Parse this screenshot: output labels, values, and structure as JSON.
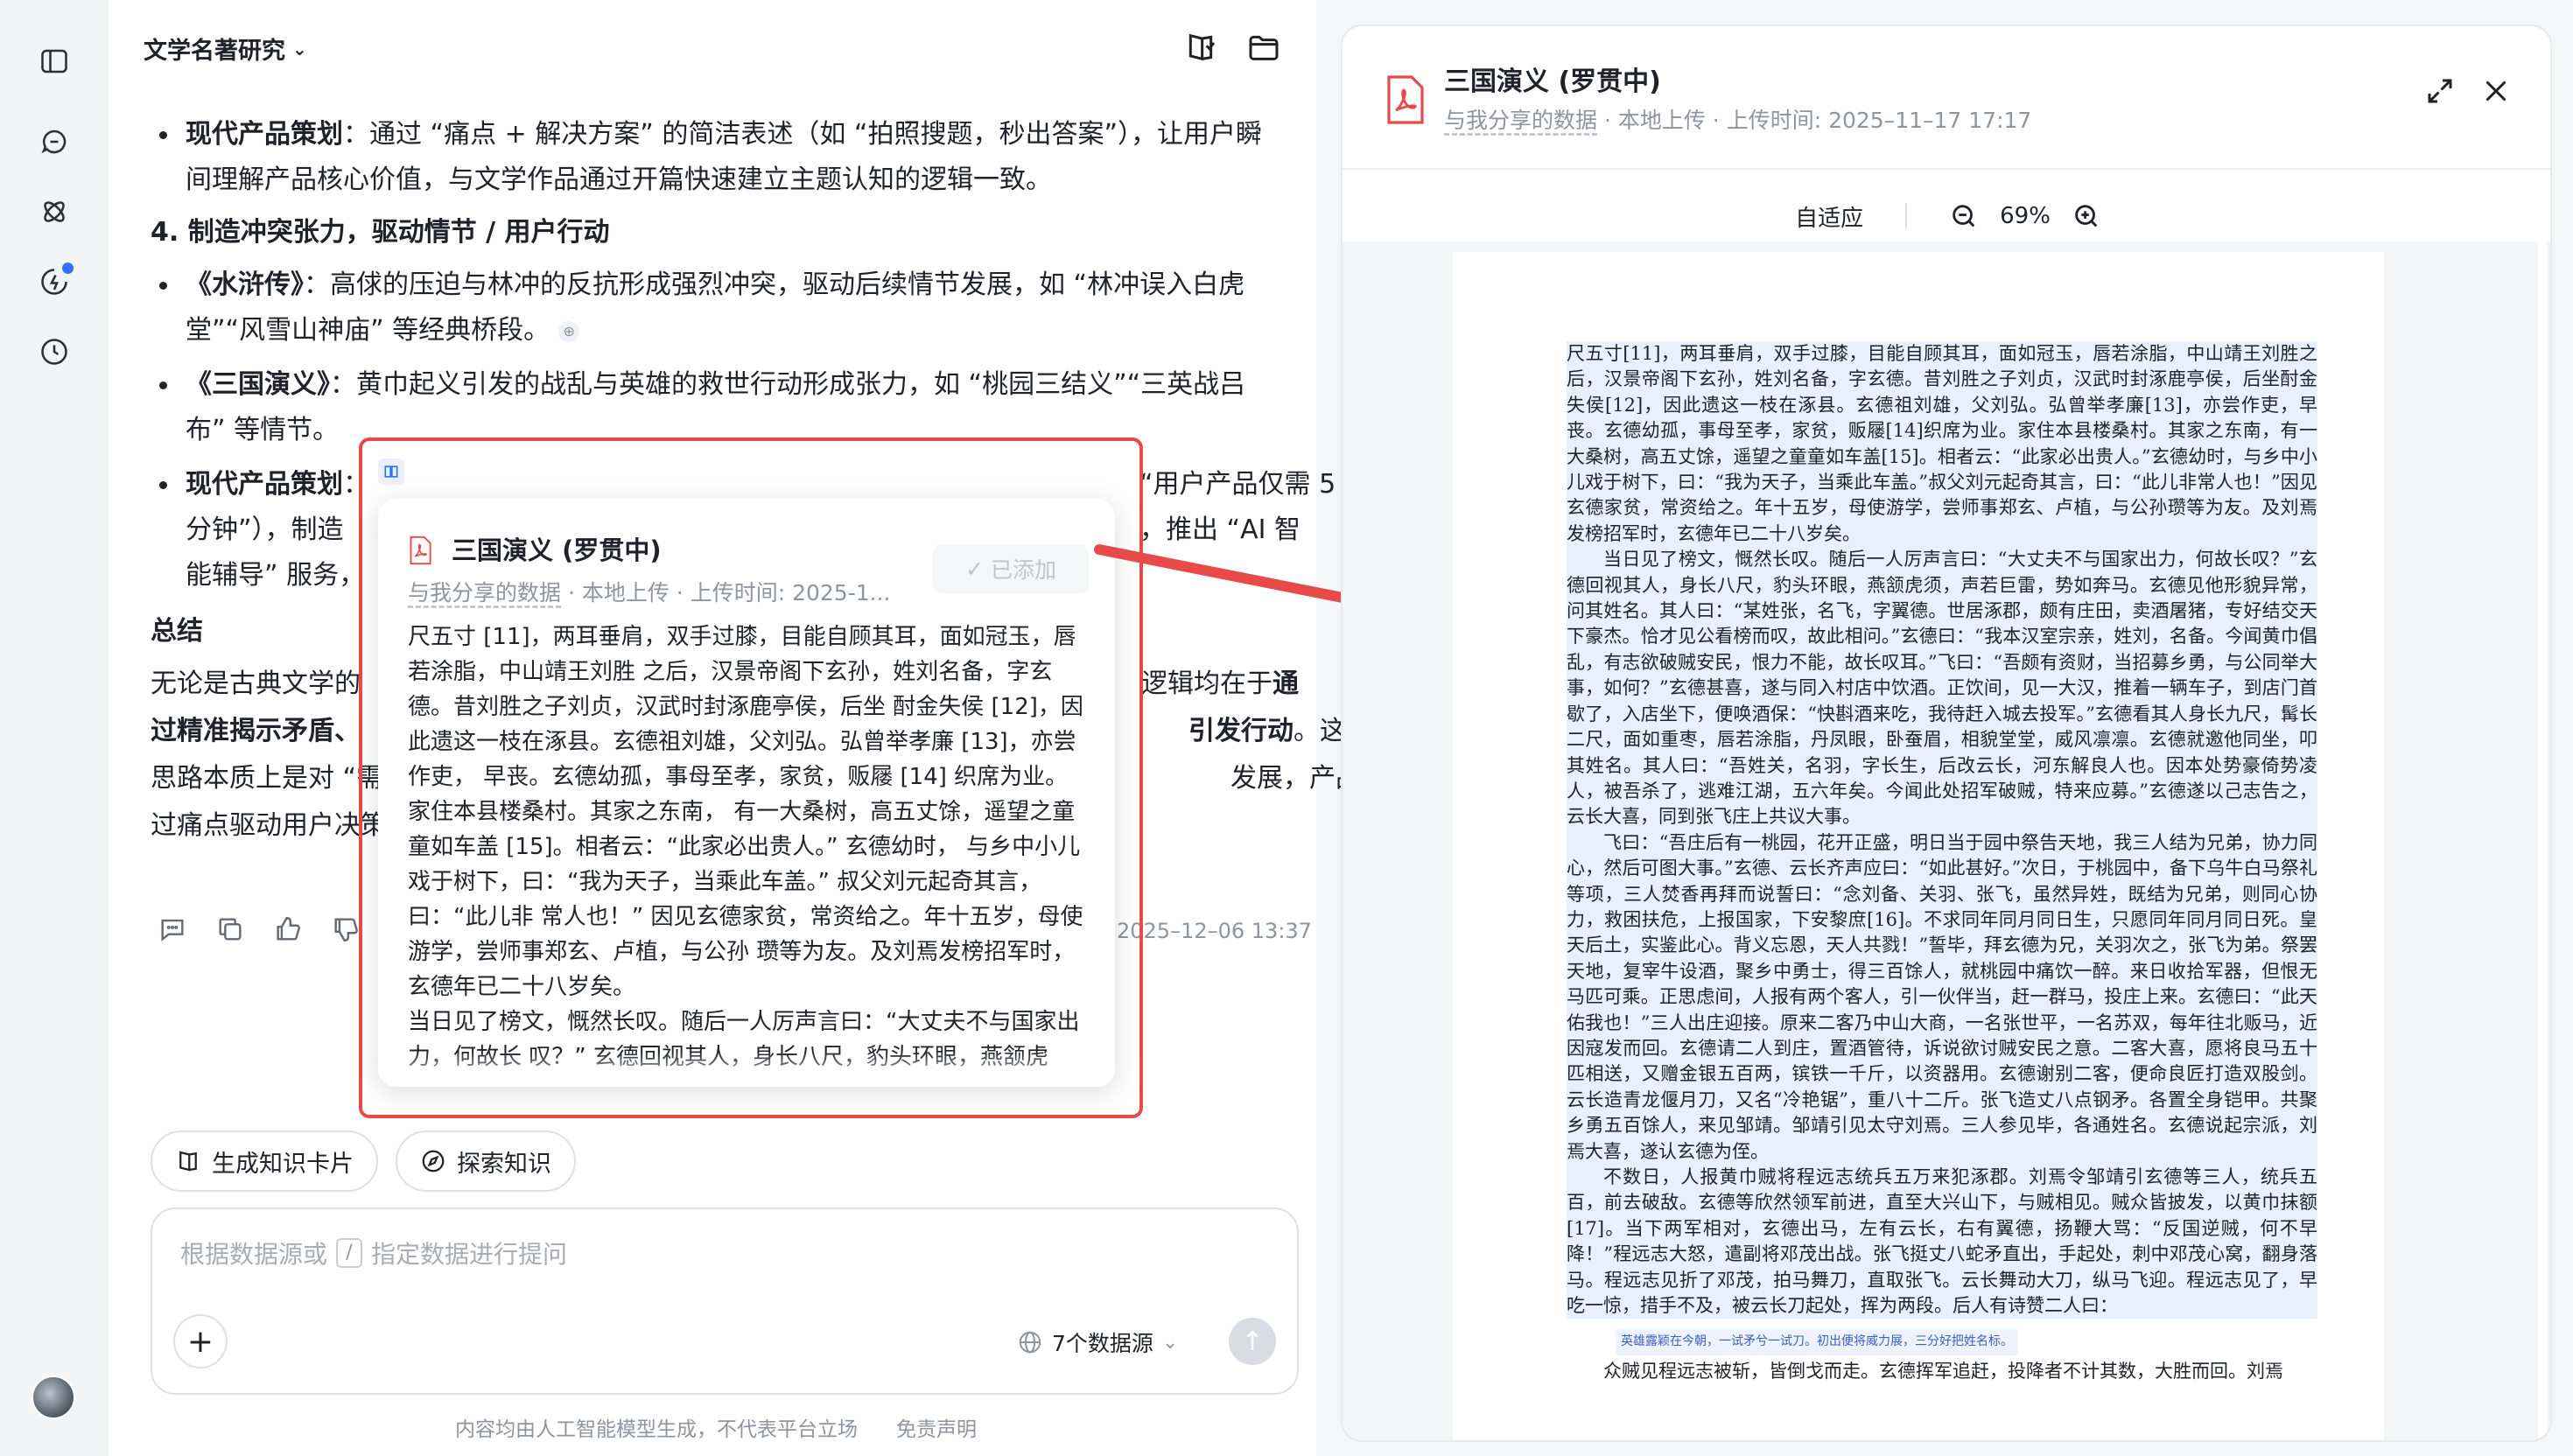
{
  "chat": {
    "title": "文学名著研究",
    "b1_head": "现代产品策划",
    "b1_text": "：通过 “痛点 + 解决方案” 的简洁表述（如 “拍照搜题，秒出答案”），让用户瞬间理解产品核心价值，与文学作品通过开篇快速建立主题认知的逻辑一致。",
    "section4": "4. 制造冲突张力，驱动情节 / 用户行动",
    "b2_head": "《水浒传》",
    "b2_text": "：高俅的压迫与林冲的反抗形成强烈冲突，驱动后续情节发展，如 “林冲误入白虎堂”“风雪山神庙” 等经典桥段。",
    "b3_head": "《三国演义》",
    "b3_text": "：黄巾起义引发的战乱与英雄的救世行动形成张力，如 “桃园三结义”“三英战吕布” 等情节。",
    "b4_head": "现代产品策划",
    "b4_line1": "：",
    "b4_right1": "“用户产品仅需 5",
    "b4_line2": "分钟”），制造",
    "b4_right2": "，推出 “AI 智",
    "b4_line3": "能辅导” 服务，",
    "summary_head": "总结",
    "summary_l1a": "无论是古典文学的",
    "summary_l1b": "逻辑均在于",
    "summary_l1c": "通",
    "summary_l2a": "过精准揭示矛盾、",
    "summary_l2b": "引发行动",
    "summary_l2c": "。这种",
    "summary_l3a": "思路本质上是对 “需",
    "summary_l3b": "发展，产品通",
    "summary_l4a": "过痛点驱动用户决策",
    "time": "2025–12–06 13:37",
    "chip_card": "生成知识卡片",
    "chip_explore": "探索知识",
    "placeholder_a": "根据数据源或",
    "placeholder_slash": "/",
    "placeholder_b": "指定数据进行提问",
    "data_sources": "7个数据源",
    "disclaimer": "内容均由人工智能模型生成，不代表平台立场",
    "disclaimer_link": "免责声明"
  },
  "popover": {
    "title": "三国演义 (罗贯中)",
    "meta_shared": "与我分享的数据",
    "meta_rest": " · 本地上传 · 上传时间:  2025-1...",
    "added": "已添加",
    "text": "尺五寸 [11]，两耳垂肩，双手过膝，目能自顾其耳，面如冠玉，唇若涂脂，中山靖王刘胜 之后，汉景帝阁下玄孙，姓刘名备，字玄德。昔刘胜之子刘贞，汉武时封涿鹿亭侯，后坐 酎金失侯 [12]，因此遗这一枝在涿县。玄德祖刘雄，父刘弘。弘曾举孝廉 [13]，亦尝作吏， 早丧。玄德幼孤，事母至孝，家贫，贩屦 [14] 织席为业。家住本县楼桑村。其家之东南， 有一大桑树，高五丈馀，遥望之童童如车盖 [15]。相者云：“此家必出贵人。” 玄德幼时， 与乡中小儿戏于树下，曰：“我为天子，当乘此车盖。” 叔父刘元起奇其言，曰：“此儿非 常人也！” 因见玄德家贫，常资给之。年十五岁，母使游学，尝师事郑玄、卢植，与公孙 瓒等为友。及刘焉发榜招军时，玄德年已二十八岁矣。\n当日见了榜文，慨然长叹。随后一人厉声言曰：“大丈夫不与国家出力，何故长 叹？” 玄德回视其人，身长八尺，豹头环眼，燕颔虎须，声若巨雷，势如奔马。玄德见他 形貌异常，问其姓名。其人"
  },
  "doc": {
    "title": "三国演义 (罗贯中)",
    "meta_shared": "与我分享的数据",
    "meta_rest": " · 本地上传 · 上传时间:   2025–11–17 17:17",
    "fit": "自适应",
    "zoom": "69%",
    "p1": "尺五寸[11]，两耳垂肩，双手过膝，目能自顾其耳，面如冠玉，唇若涂脂，中山靖王刘胜之后，汉景帝阁下玄孙，姓刘名备，字玄德。昔刘胜之子刘贞，汉武时封涿鹿亭侯，后坐酎金失侯[12]，因此遗这一枝在涿县。玄德祖刘雄，父刘弘。弘曾举孝廉[13]，亦尝作吏，早丧。玄德幼孤，事母至孝，家贫，贩屦[14]织席为业。家住本县楼桑村。其家之东南，有一大桑树，高五丈馀，遥望之童童如车盖[15]。相者云：“此家必出贵人。”玄德幼时，与乡中小儿戏于树下，曰：“我为天子，当乘此车盖。”叔父刘元起奇其言，曰：“此儿非常人也！”因见玄德家贫，常资给之。年十五岁，母使游学，尝师事郑玄、卢植，与公孙瓒等为友。及刘焉发榜招军时，玄德年已二十八岁矣。",
    "p2": "当日见了榜文，慨然长叹。随后一人厉声言曰：“大丈夫不与国家出力，何故长叹？”玄德回视其人，身长八尺，豹头环眼，燕颔虎须，声若巨雷，势如奔马。玄德见他形貌异常，问其姓名。其人曰：“某姓张，名飞，字翼德。世居涿郡，颇有庄田，卖酒屠猪，专好结交天下豪杰。恰才见公看榜而叹，故此相问。”玄德曰：“我本汉室宗亲，姓刘，名备。今闻黄巾倡乱，有志欲破贼安民，恨力不能，故长叹耳。”飞曰：“吾颇有资财，当招募乡勇，与公同举大事，如何？”玄德甚喜，遂与同入村店中饮酒。正饮间，见一大汉，推着一辆车子，到店门首歇了，入店坐下，便唤酒保：“快斟酒来吃，我待赶入城去投军。”玄德看其人身长九尺，髯长二尺，面如重枣，唇若涂脂，丹凤眼，卧蚕眉，相貌堂堂，威风凛凛。玄德就邀他同坐，叩其姓名。其人曰：“吾姓关，名羽，字长生，后改云长，河东解良人也。因本处势豪倚势凌人，被吾杀了，逃难江湖，五六年矣。今闻此处招军破贼，特来应募。”玄德遂以己志告之，云长大喜，同到张飞庄上共议大事。",
    "p3": "飞曰：“吾庄后有一桃园，花开正盛，明日当于园中祭告天地，我三人结为兄弟，协力同心，然后可图大事。”玄德、云长齐声应曰：“如此甚好。”次日，于桃园中，备下乌牛白马祭礼等项，三人焚香再拜而说誓曰：“念刘备、关羽、张飞，虽然异姓，既结为兄弟，则同心协力，救困扶危，上报国家，下安黎庶[16]。不求同年同月同日生，只愿同年同月同日死。皇天后土，实鉴此心。背义忘恩，天人共戮！”誓毕，拜玄德为兄，关羽次之，张飞为弟。祭罢天地，复宰牛设酒，聚乡中勇士，得三百馀人，就桃园中痛饮一醉。来日收拾军器，但恨无马匹可乘。正思虑间，人报有两个客人，引一伙伴当，赶一群马，投庄上来。玄德曰：“此天佑我也！”三人出庄迎接。原来二客乃中山大商，一名张世平，一名苏双，每年往北贩马，近因寇发而回。玄德请二人到庄，置酒管待，诉说欲讨贼安民之意。二客大喜，愿将良马五十匹相送，又赠金银五百两，镔铁一千斤，以资器用。玄德谢别二客，便命良匠打造双股剑。云长造青龙偃月刀，又名“冷艳锯”，重八十二斤。张飞造丈八点钢矛。各置全身铠甲。共聚乡勇五百馀人，来见邹靖。邹靖引见太守刘焉。三人参见毕，各通姓名。玄德说起宗派，刘焉大喜，遂认玄德为侄。",
    "p4": "不数日，人报黄巾贼将程远志统兵五万来犯涿郡。刘焉令邹靖引玄德等三人，统兵五百，前去破敌。玄德等欣然领军前进，直至大兴山下，与贼相见。贼众皆披发，以黄巾抹额[17]。当下两军相对，玄德出马，左有云长，右有翼德，扬鞭大骂：“反国逆贼，何不早降！”程远志大怒，遣副将邓茂出战。张飞挺丈八蛇矛直出，手起处，刺中邓茂心窝，翻身落马。程远志见折了邓茂，拍马舞刀，直取张飞。云长舞动大刀，纵马飞迎。程远志见了，早吃一惊，措手不及，被云长刀起处，挥为两段。后人有诗赞二人曰：",
    "poem": "英雄露颖在今朝，一试矛兮一试刀。初出便将威力展，三分好把姓名标。",
    "p5": "众贼见程远志被斩，皆倒戈而走。玄德挥军追赶，投降者不计其数，大胜而回。刘焉"
  },
  "icons": {
    "rail": [
      "sidebar-toggle-icon",
      "chat-icon",
      "explore-icon",
      "spark-icon",
      "history-icon"
    ],
    "header": [
      "knowledge-card-icon",
      "folder-icon"
    ]
  },
  "colors": {
    "accent": "#3370ff",
    "annotation": "#e84a4a",
    "highlight": "#e8effd"
  }
}
